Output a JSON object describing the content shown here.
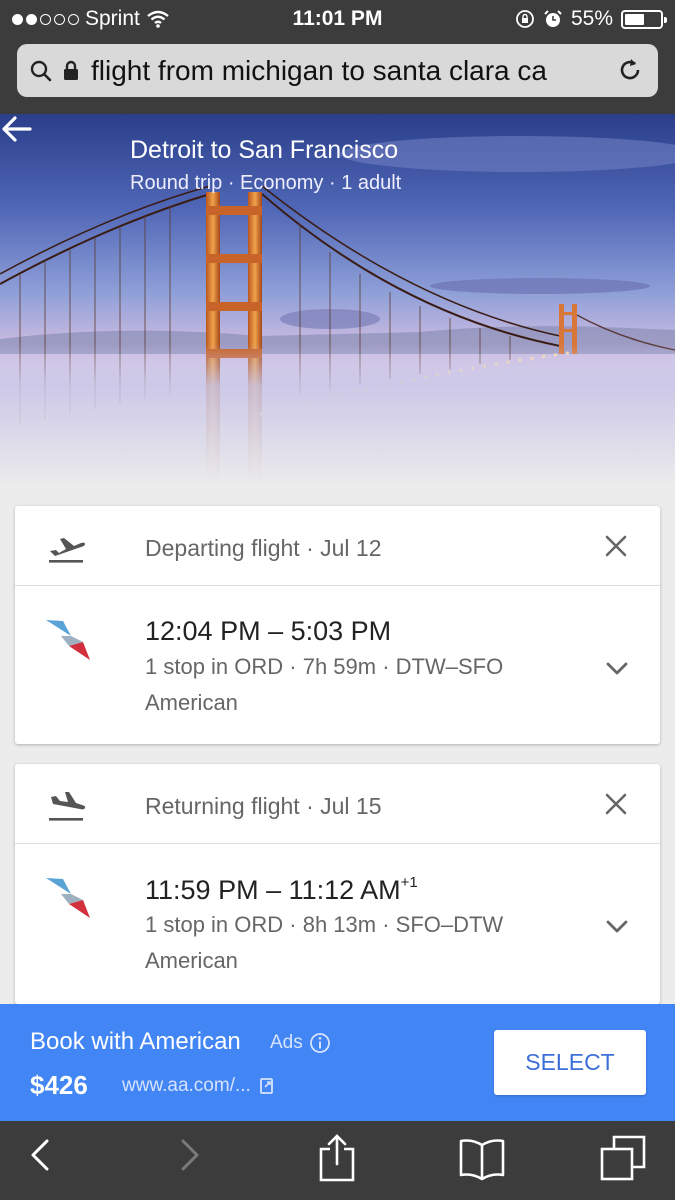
{
  "status_bar": {
    "carrier": "Sprint",
    "time": "11:01 PM",
    "battery": "55%",
    "battery_level": 0.55
  },
  "address_bar": {
    "query": "flight from michigan to santa clara ca"
  },
  "hero": {
    "title": "Detroit to San Francisco",
    "subtitle": "Round trip · Economy · 1 adult"
  },
  "departing": {
    "label": "Departing flight · Jul 12",
    "times": "12:04 PM – 5:03 PM",
    "details": "1 stop in ORD · 7h 59m · DTW–SFO",
    "airline": "American"
  },
  "returning": {
    "label": "Returning flight · Jul 15",
    "times": "11:59 PM – 11:12 AM",
    "day_offset": "+1",
    "details": "1 stop in ORD · 8h 13m · SFO–DTW",
    "airline": "American"
  },
  "ad": {
    "title": "Book with American",
    "tag": "Ads",
    "price": "$426",
    "url": "www.aa.com/...",
    "button": "SELECT"
  },
  "icons": {
    "search": "search-icon",
    "lock": "lock-icon",
    "reload": "reload-icon",
    "back": "back-arrow-icon",
    "depart": "takeoff-icon",
    "return": "landing-icon",
    "close": "close-icon",
    "expand": "chevron-down-icon",
    "info": "info-icon",
    "external": "external-link-icon",
    "share": "share-icon",
    "bookmarks": "bookmarks-icon",
    "tabs": "tabs-icon"
  },
  "colors": {
    "accent": "#4285f4",
    "chrome": "#3c3c3c"
  }
}
